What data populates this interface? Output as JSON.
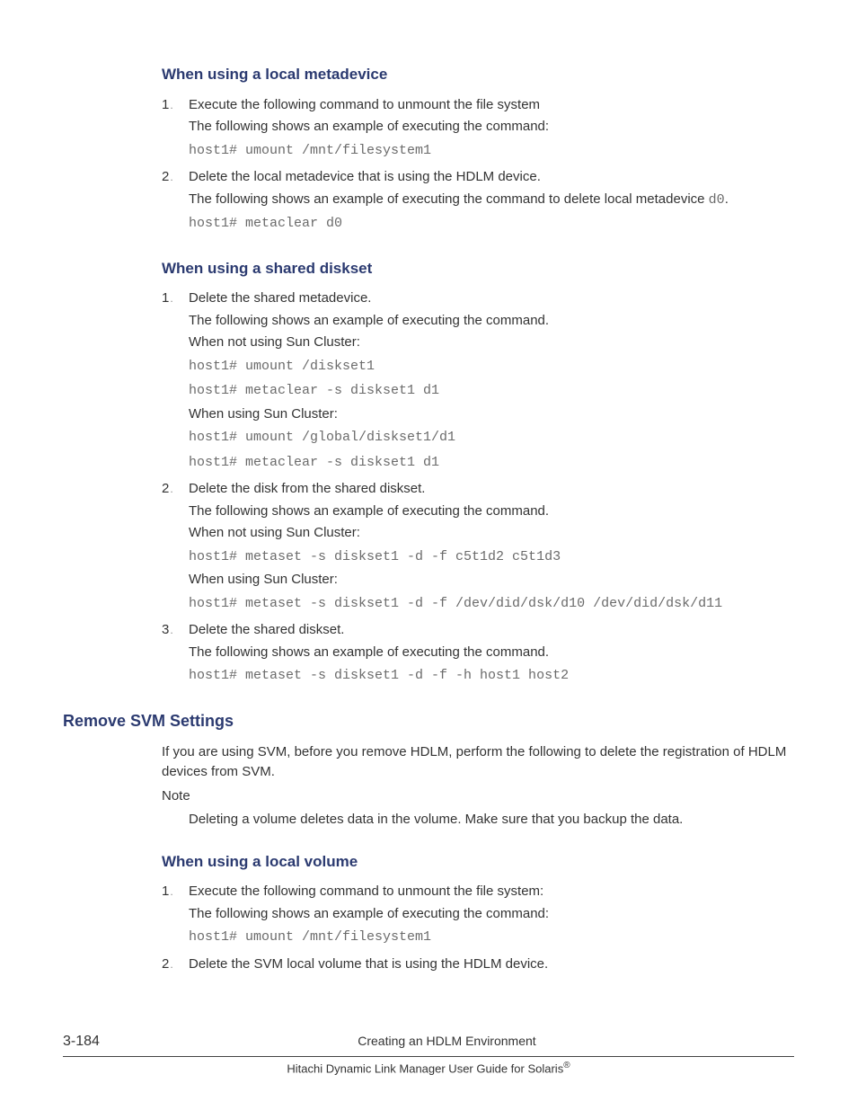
{
  "sections": {
    "local_metadevice": {
      "heading": "When using a local metadevice",
      "step1_num": "1",
      "step1_line1": "Execute the following command to unmount the file system",
      "step1_line2": "The following shows an example of executing the command:",
      "step1_cmd": "host1# umount /mnt/filesystem1",
      "step2_num": "2",
      "step2_line1": "Delete the local metadevice that is using the HDLM device.",
      "step2_line2a": "The following shows an example of executing the command to delete local metadevice ",
      "step2_line2b": "d0",
      "step2_line2c": ".",
      "step2_cmd": "host1# metaclear d0"
    },
    "shared_diskset": {
      "heading": "When using a shared diskset",
      "s1_num": "1",
      "s1_l1": "Delete the shared metadevice.",
      "s1_l2": "The following shows an example of executing the command.",
      "s1_l3": "When not using Sun Cluster:",
      "s1_cmd1": "host1# umount /diskset1",
      "s1_cmd2": "host1# metaclear -s diskset1 d1",
      "s1_l4": "When using Sun Cluster:",
      "s1_cmd3": "host1# umount /global/diskset1/d1",
      "s1_cmd4": "host1# metaclear -s diskset1 d1",
      "s2_num": "2",
      "s2_l1": "Delete the disk from the shared diskset.",
      "s2_l2": "The following shows an example of executing the command.",
      "s2_l3": "When not using Sun Cluster:",
      "s2_cmd1": "host1# metaset -s diskset1 -d -f c5t1d2 c5t1d3",
      "s2_l4": "When using Sun Cluster:",
      "s2_cmd2": "host1# metaset -s diskset1 -d -f /dev/did/dsk/d10 /dev/did/dsk/d11",
      "s3_num": "3",
      "s3_l1": "Delete the shared diskset.",
      "s3_l2": "The following shows an example of executing the command.",
      "s3_cmd1": "host1# metaset -s diskset1 -d -f -h host1 host2"
    },
    "remove_svm": {
      "heading": "Remove SVM Settings",
      "p1": "If you are using SVM, before you remove HDLM, perform the following to delete the registration of HDLM devices from SVM.",
      "note_label": "Note",
      "note_body": "Deleting a volume deletes data in the volume. Make sure that you backup the data."
    },
    "local_volume": {
      "heading": "When using a local volume",
      "s1_num": "1",
      "s1_l1": "Execute the following command to unmount the file system:",
      "s1_l2": "The following shows an example of executing the command:",
      "s1_cmd": "host1# umount /mnt/filesystem1",
      "s2_num": "2",
      "s2_l1": "Delete the SVM local volume that is using the HDLM device."
    }
  },
  "footer": {
    "pagenum": "3-184",
    "chapter": "Creating an HDLM Environment",
    "guide_a": "Hitachi Dynamic Link Manager User Guide for Solaris",
    "guide_reg": "®"
  }
}
